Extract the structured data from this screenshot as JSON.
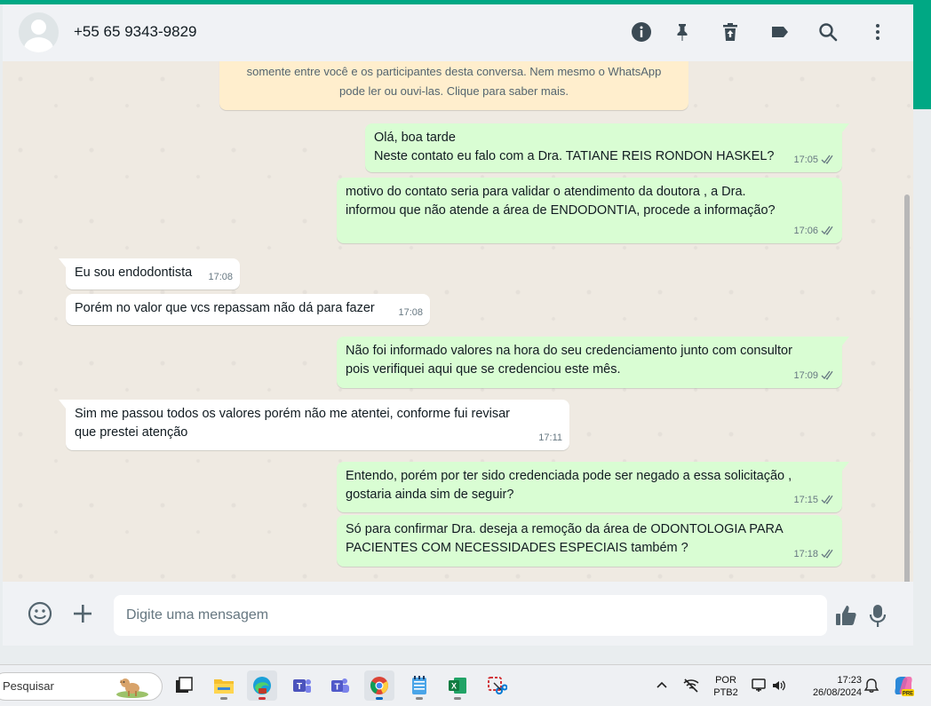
{
  "header": {
    "contact_name": "+55 65 9343-9829",
    "icons": [
      "info-icon",
      "pin-icon",
      "delete-icon",
      "label-icon",
      "search-icon",
      "more-vert-icon"
    ]
  },
  "encryption_notice": {
    "line1": "somente entre você e os participantes desta conversa. Nem mesmo o WhatsApp",
    "line2": "pode ler ou ouvi-las. Clique para saber mais."
  },
  "messages": [
    {
      "direction": "out",
      "lines": [
        "Olá, boa tarde",
        "Neste contato eu falo com a Dra. TATIANE REIS RONDON HASKEL?"
      ],
      "time": "17:05",
      "status": "read"
    },
    {
      "direction": "out",
      "lines": [
        "motivo do contato seria para validar o atendimento da doutora , a Dra.",
        "informou que não atende a área de ENDODONTIA, procede a informação?"
      ],
      "time": "17:06",
      "status": "read"
    },
    {
      "direction": "in",
      "lines": [
        "Eu sou endodontista"
      ],
      "time": "17:08"
    },
    {
      "direction": "in",
      "lines": [
        "Porém no valor que vcs repassam não dá para fazer"
      ],
      "time": "17:08"
    },
    {
      "direction": "out",
      "lines": [
        "Não foi informado valores na hora do seu credenciamento junto com consultor",
        "pois verifiquei aqui que se credenciou este mês."
      ],
      "time": "17:09",
      "status": "read"
    },
    {
      "direction": "in",
      "lines": [
        "Sim me passou todos os valores porém não me atentei, conforme fui revisar",
        "que prestei atenção"
      ],
      "time": "17:11"
    },
    {
      "direction": "out",
      "lines": [
        "Entendo, porém por ter sido credenciada pode ser negado a essa solicitação ,",
        "gostaria ainda sim de seguir?"
      ],
      "time": "17:15",
      "status": "read"
    },
    {
      "direction": "out",
      "lines": [
        "Só para confirmar Dra. deseja a remoção da área de  ODONTOLOGIA PARA",
        "PACIENTES COM NECESSIDADES ESPECIAIS também ?"
      ],
      "time": "17:18",
      "status": "read"
    }
  ],
  "composer": {
    "placeholder": "Digite uma mensagem",
    "value": "",
    "icons": [
      "emoji-icon",
      "plus-icon",
      "thumbs-up-icon",
      "mic-icon"
    ]
  },
  "taskbar": {
    "search_placeholder": "Pesquisar",
    "language_line1": "POR",
    "language_line2": "PTB2",
    "time": "17:23",
    "date": "26/08/2024",
    "apps": [
      "widgets-icon",
      "file-explorer-icon",
      "edge-icon",
      "teams-icon",
      "teams-classic-icon",
      "chrome-icon",
      "notepad-icon",
      "excel-icon",
      "snipping-tool-icon"
    ]
  },
  "colors": {
    "accent": "#00a884",
    "outgoing_bubble": "#d9fdd3",
    "incoming_bubble": "#ffffff",
    "notice_bg": "#ffeecd",
    "read_ticks": "#667781"
  }
}
